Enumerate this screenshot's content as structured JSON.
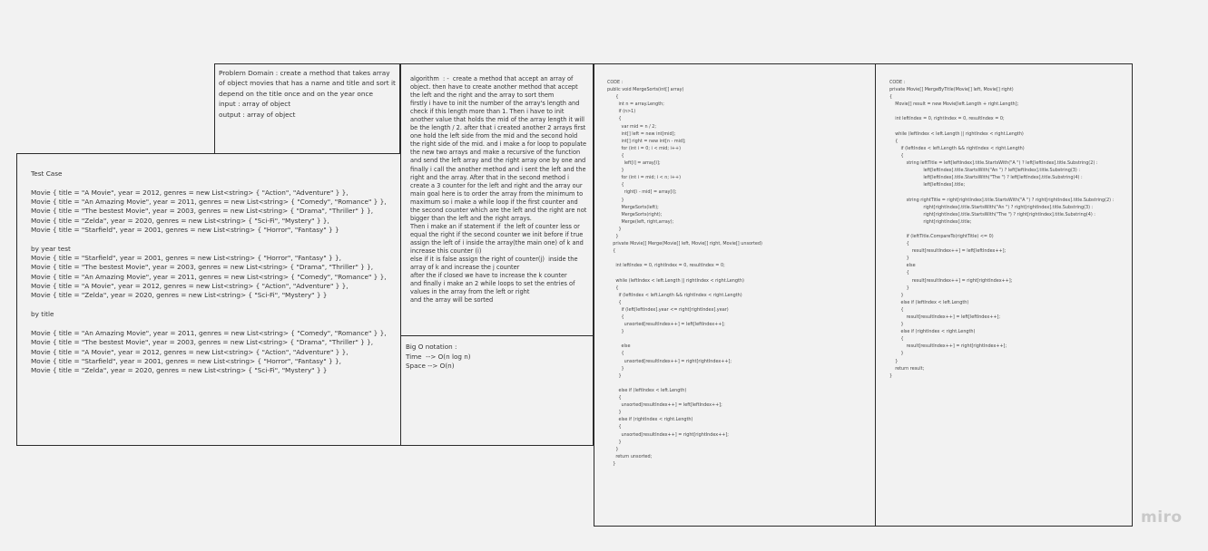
{
  "problem_domain": {
    "text": "Problem Domain : create a method that takes array of object movies that has a name and title and sort it depend on the title once and on the year once\ninput : array of object\noutput : array of object"
  },
  "algorithm": {
    "text": "algorithm  : -  create a method that accept an array of object. then have to create another method that accept the left and the right and the array to sort them\nfirstly i have to init the number of the array's length and check if this length more than 1. Then i have to init another value that holds the mid of the array length it will be the length / 2. after that i created another 2 arrays first one hold the left side from the mid and the second hold the right side of the mid. and i make a for loop to populate the new two arrays and make a recursive of the function and send the left array and the right array one by one and finally i call the another method and i sent the left and the right and the array. After that in the second method i create a 3 counter for the left and right and the array our main goal here is to order the array from the minimum to maximum so i make a while loop if the first counter and the second counter which are the left and the right are not bigger than the left and the right arrays.\nThen i make an if statement if  the left of counter less or equal the right if the second counter we init before if true assign the left of i inside the array(the main one) of k and increase this counter (i)\nelse if it is false assign the right of counter(j)  inside the array of k and increase the j counter\nafter the if closed we have to increase the k counter\nand finally i make an 2 while loops to set the entries of values in the array from the left or right\nand the array will be sorted"
  },
  "big_o": {
    "text": "Big O notation :\nTime  --> O(n log n)\nSpace --> O(n)"
  },
  "test_case": {
    "text": "Test Case\n\nMovie { title = \"A Movie\", year = 2012, genres = new List<string> { \"Action\", \"Adventure\" } },\nMovie { title = \"An Amazing Movie\", year = 2011, genres = new List<string> { \"Comedy\", \"Romance\" } },\nMovie { title = \"The bestest Movie\", year = 2003, genres = new List<string> { \"Drama\", \"Thriller\" } },\nMovie { title = \"Zelda\", year = 2020, genres = new List<string> { \"Sci-Fi\", \"Mystery\" } },\nMovie { title = \"Starfield\", year = 2001, genres = new List<string> { \"Horror\", \"Fantasy\" } }\n\nby year test\nMovie { title = \"Starfield\", year = 2001, genres = new List<string> { \"Horror\", \"Fantasy\" } },\nMovie { title = \"The bestest Movie\", year = 2003, genres = new List<string> { \"Drama\", \"Thriller\" } },\nMovie { title = \"An Amazing Movie\", year = 2011, genres = new List<string> { \"Comedy\", \"Romance\" } },\nMovie { title = \"A Movie\", year = 2012, genres = new List<string> { \"Action\", \"Adventure\" } },\nMovie { title = \"Zelda\", year = 2020, genres = new List<string> { \"Sci-Fi\", \"Mystery\" } }\n\nby title\n\nMovie { title = \"An Amazing Movie\", year = 2011, genres = new List<string> { \"Comedy\", \"Romance\" } },\nMovie { title = \"The bestest Movie\", year = 2003, genres = new List<string> { \"Drama\", \"Thriller\" } },\nMovie { title = \"A Movie\", year = 2012, genres = new List<string> { \"Action\", \"Adventure\" } },\nMovie { title = \"Starfield\", year = 2001, genres = new List<string> { \"Horror\", \"Fantasy\" } },\nMovie { title = \"Zelda\", year = 2020, genres = new List<string> { \"Sci-Fi\", \"Mystery\" } }"
  },
  "code_merge_sort": {
    "text": "CODE :\npublic void MergeSorts(int[] array)\n      {\n        int n = array.Length;\n        if (n>1)\n        {\n          var mid = n / 2;\n          int[] left = new int[mid];\n          int[] right = new int[n - mid];\n          for (int i = 0; i < mid; i++)\n          {\n            left[i] = array[i];\n          }\n          for (int i = mid; i < n; i++)\n          {\n            right[i - mid] = array[i];\n          }\n          MergeSorts(left);\n          MergeSorts(right);\n          Merge(left, right,array);\n        }\n      }\n    private Movie[] Merge(Movie[] left, Movie[] right, Movie[] unsorted)\n    {\n\n      int leftIndex = 0, rightIndex = 0, resultIndex = 0;\n\n      while (leftIndex < left.Length || rightIndex < right.Length)\n      {\n        if (leftIndex < left.Length && rightIndex < right.Length)\n        {\n          if (left[leftIndex].year <= right[rightIndex].year)\n          {\n            unsorted[resultIndex++] = left[leftIndex++];\n          }\n\n          else\n          {\n            unsorted[resultIndex++] = right[rightIndex++];\n          }\n        }\n\n        else if (leftIndex < left.Length)\n        {\n          unsorted[resultIndex++] = left[leftIndex++];\n        }\n        else if (rightIndex < right.Length)\n        {\n          unsorted[resultIndex++] = right[rightIndex++];\n        }\n      }\n      return unsorted;\n    }"
  },
  "code_merge_by_title": {
    "text": "CODE :\nprivate Movie[] MergeByTitle(Movie[] left, Movie[] right)\n{\n    Movie[] result = new Movie[left.Length + right.Length];\n\n    int leftIndex = 0, rightIndex = 0, resultIndex = 0;\n\n    while (leftIndex < left.Length || rightIndex < right.Length)\n    {\n        if (leftIndex < left.Length && rightIndex < right.Length)\n        {\n            string leftTitle = left[leftIndex].title.StartsWith(\"A \") ? left[leftIndex].title.Substring(2) :\n                        left[leftIndex].title.StartsWith(\"An \") ? left[leftIndex].title.Substring(3) :\n                        left[leftIndex].title.StartsWith(\"The \") ? left[leftIndex].title.Substring(4) :\n                        left[leftIndex].title;\n\n            string rightTitle = right[rightIndex].title.StartsWith(\"A \") ? right[rightIndex].title.Substring(2) :\n                        right[rightIndex].title.StartsWith(\"An \") ? right[rightIndex].title.Substring(3) :\n                        right[rightIndex].title.StartsWith(\"The \") ? right[rightIndex].title.Substring(4) :\n                        right[rightIndex].title;\n\n            if (leftTitle.CompareTo(rightTitle) <= 0)\n            {\n                result[resultIndex++] = left[leftIndex++];\n            }\n            else\n            {\n                result[resultIndex++] = right[rightIndex++];\n            }\n        }\n        else if (leftIndex < left.Length)\n        {\n            result[resultIndex++] = left[leftIndex++];\n        }\n        else if (rightIndex < right.Length)\n        {\n            result[resultIndex++] = right[rightIndex++];\n        }\n    }\n    return result;\n}"
  },
  "watermark": {
    "text": "miro"
  }
}
